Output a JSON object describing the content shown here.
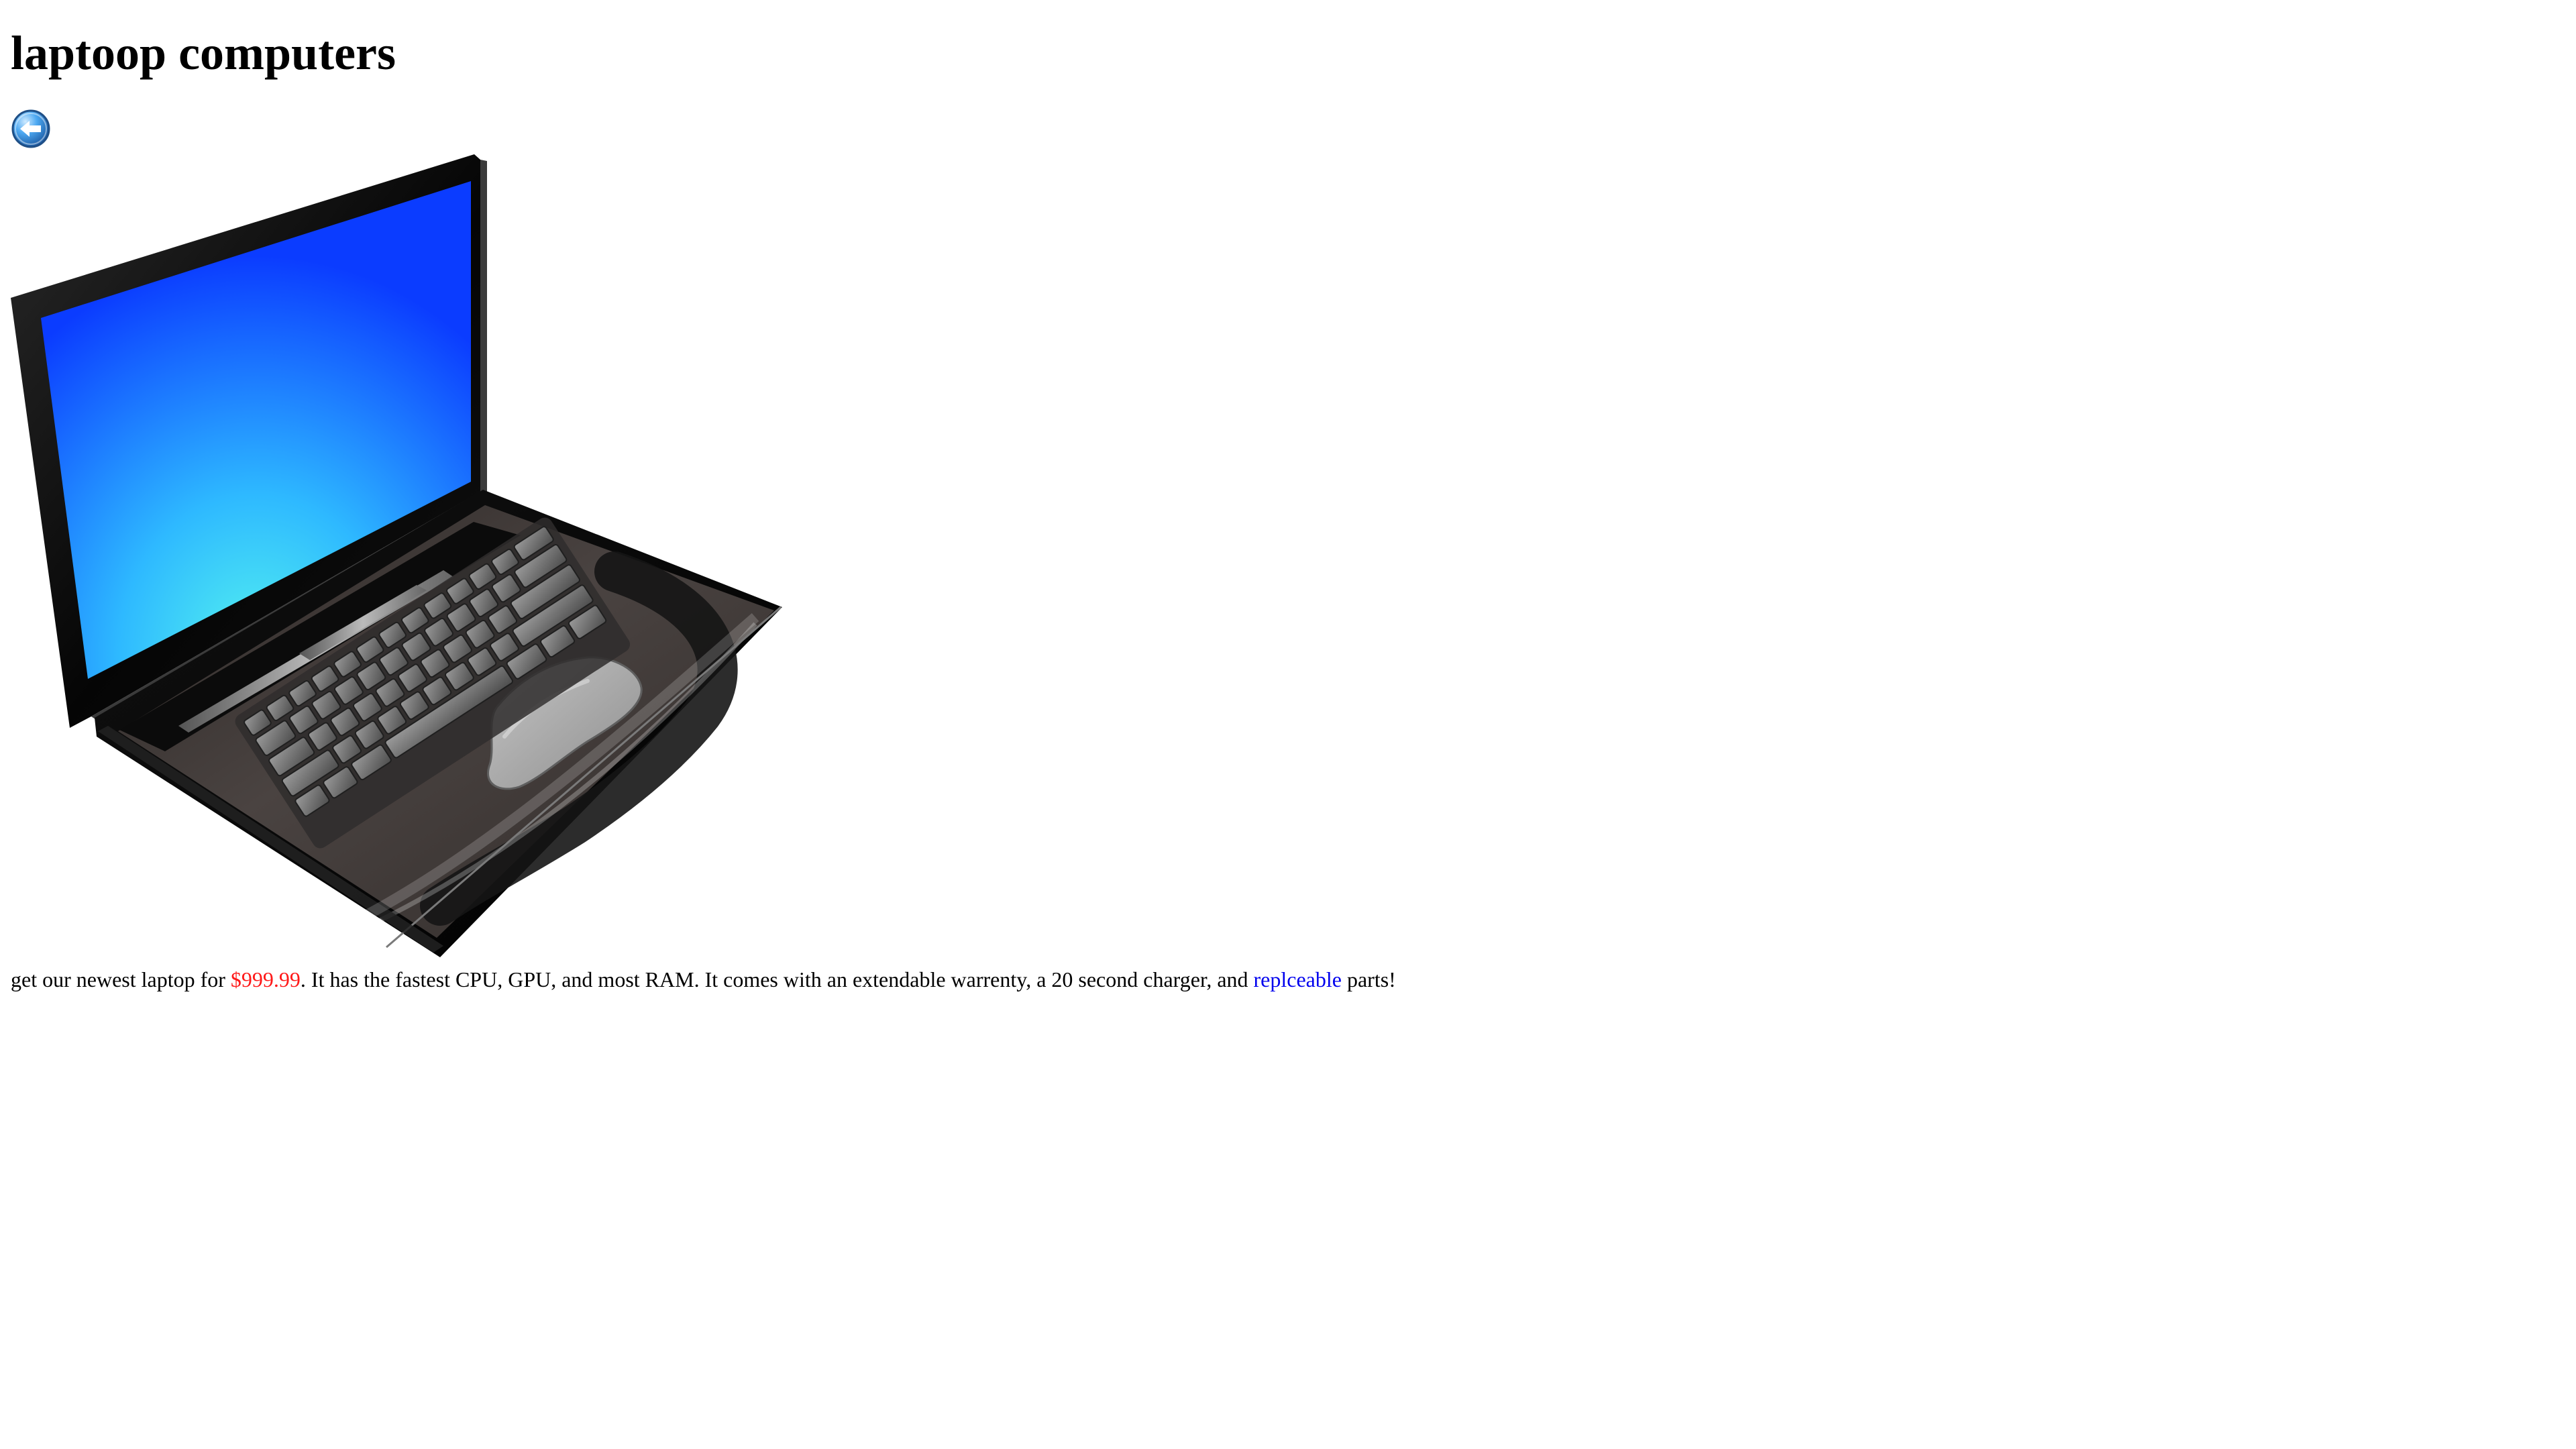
{
  "page": {
    "title": "laptoop computers"
  },
  "nav": {
    "back_icon": "back-arrow-icon"
  },
  "product": {
    "image_icon": "laptop-image",
    "description": {
      "text_1": "get our newest laptop for ",
      "price": "$999.99",
      "text_2": ". It has the fastest CPU, GPU, and most RAM. It comes with an extendable warrenty, a 20 second charger, and ",
      "link_text": "replceable",
      "text_3": " parts!"
    }
  },
  "colors": {
    "price": "#ff1a1a",
    "link": "#0000ee",
    "screen": "#1f63ff"
  }
}
